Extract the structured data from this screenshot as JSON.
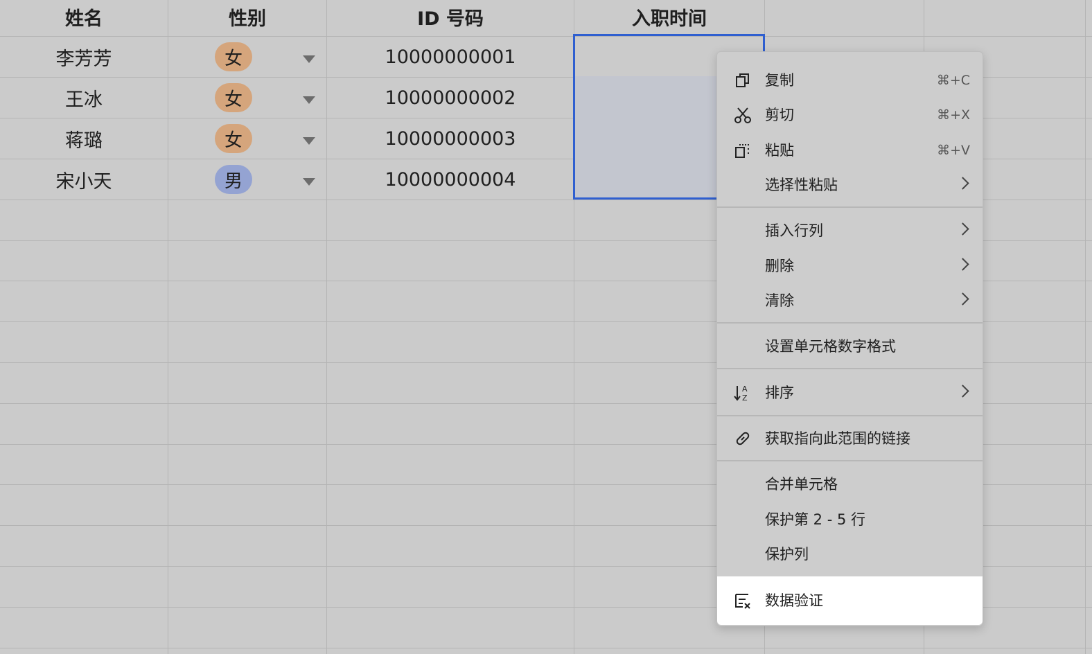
{
  "columns": [
    "姓名",
    "性别",
    "ID 号码",
    "入职时间"
  ],
  "rows": [
    {
      "name": "李芳芳",
      "gender": "女",
      "id": "10000000001"
    },
    {
      "name": "王冰",
      "gender": "女",
      "id": "10000000002"
    },
    {
      "name": "蒋璐",
      "gender": "女",
      "id": "10000000003"
    },
    {
      "name": "宋小天",
      "gender": "男",
      "id": "10000000004"
    }
  ],
  "colors": {
    "female_tag": "#d5a57c",
    "male_tag": "#94a3d2",
    "selection": "#2f5fd0",
    "highlight": "#ffffff"
  },
  "menu": {
    "copy": {
      "label": "复制",
      "shortcut": "⌘+C",
      "icon": "copy-icon"
    },
    "cut": {
      "label": "剪切",
      "shortcut": "⌘+X",
      "icon": "scissors-icon"
    },
    "paste": {
      "label": "粘贴",
      "shortcut": "⌘+V",
      "icon": "paste-icon"
    },
    "paste_special": {
      "label": "选择性粘贴"
    },
    "insert": {
      "label": "插入行列"
    },
    "delete": {
      "label": "删除"
    },
    "clear": {
      "label": "清除"
    },
    "number_format": {
      "label": "设置单元格数字格式"
    },
    "sort": {
      "label": "排序",
      "icon": "sort-icon"
    },
    "link": {
      "label": "获取指向此范围的链接",
      "icon": "link-icon"
    },
    "merge": {
      "label": "合并单元格"
    },
    "protect_rows": {
      "label": "保护第 2 - 5 行"
    },
    "protect_col": {
      "label": "保护列"
    },
    "validation": {
      "label": "数据验证",
      "icon": "data-validation-icon"
    }
  }
}
